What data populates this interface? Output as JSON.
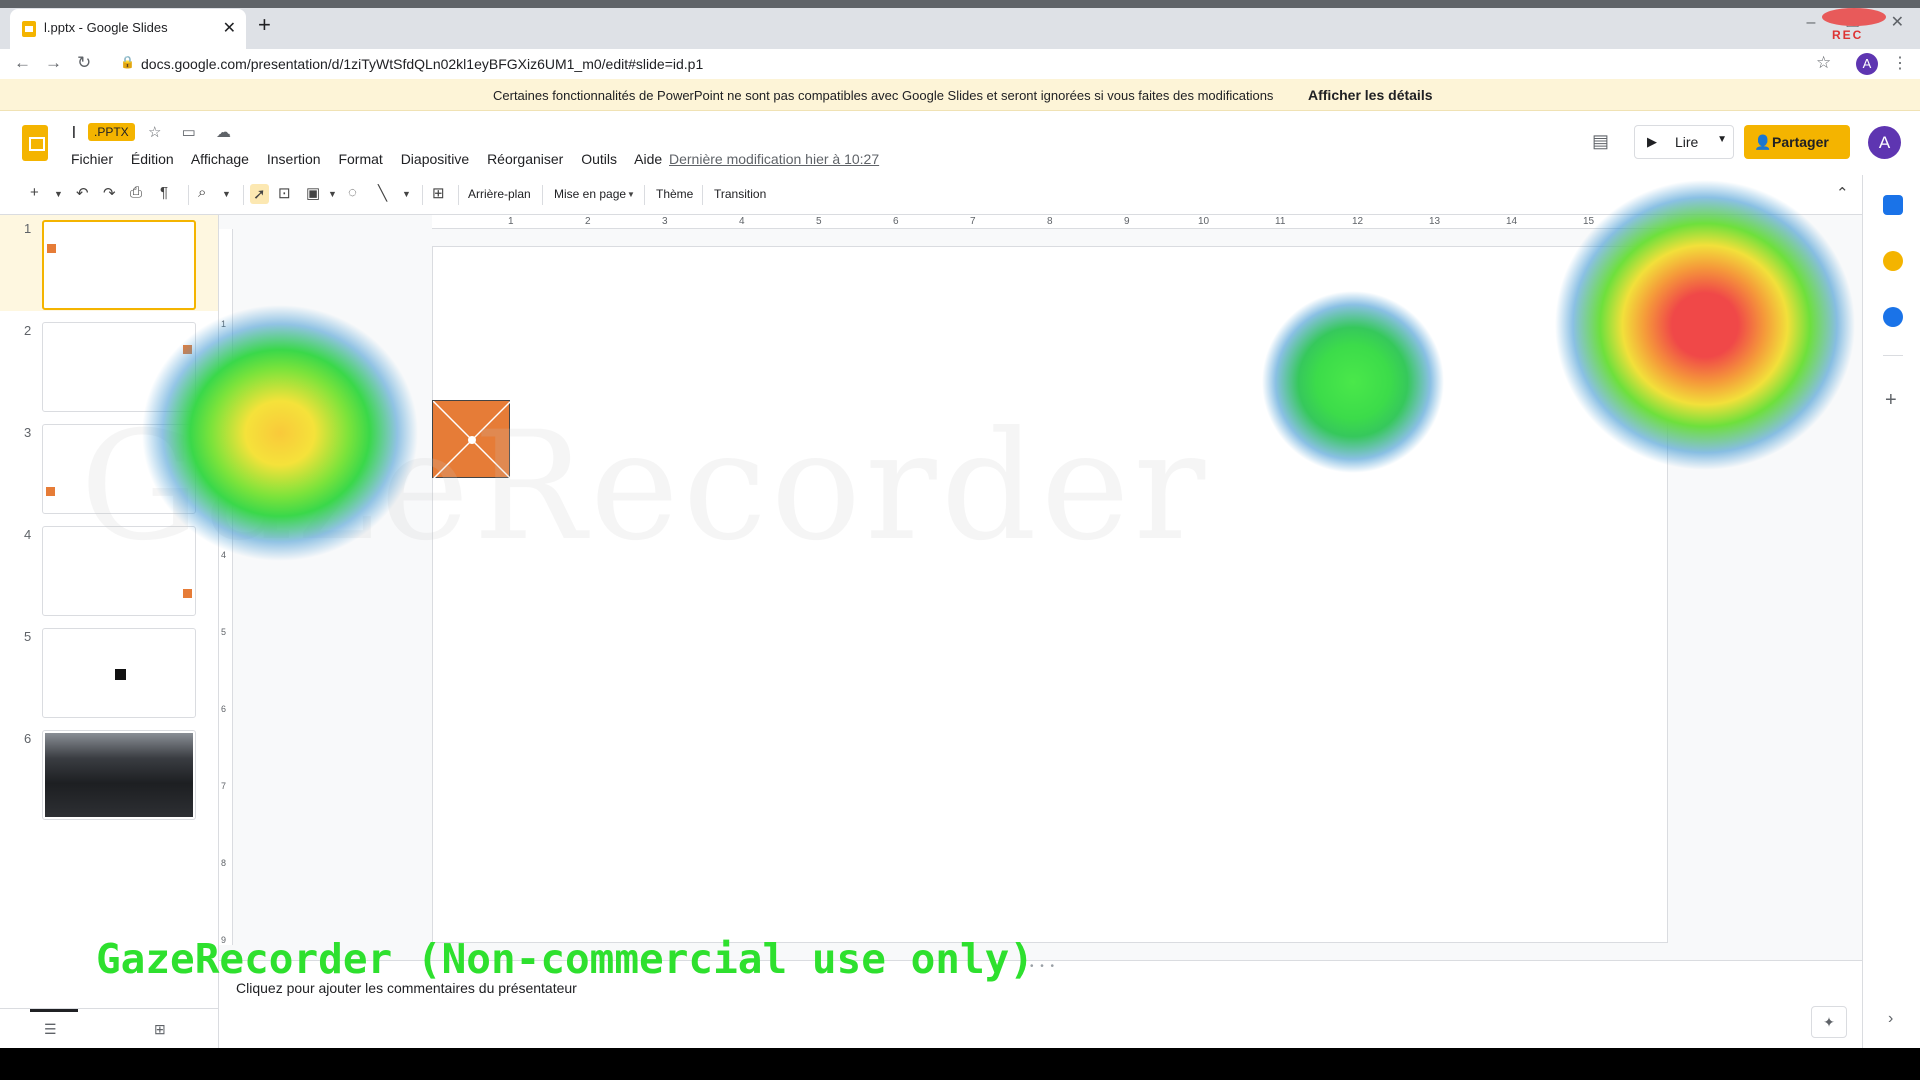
{
  "browser": {
    "tab_title": "l.pptx - Google Slides",
    "tab_close": "✕",
    "new_tab": "+",
    "url": "docs.google.com/presentation/d/1ziTyWtSfdQLn02kl1eyBFGXiz6UM1_m0/edit#slide=id.p1",
    "profile_initial": "A",
    "rec_label": "REC"
  },
  "banner": {
    "message": "Certaines fonctionnalités de PowerPoint ne sont pas compatibles avec Google Slides et seront ignorées si vous faites des modifications",
    "details_link": "Afficher les détails"
  },
  "header": {
    "doc_name": "l",
    "file_badge": ".PPTX",
    "menu": [
      "Fichier",
      "Édition",
      "Affichage",
      "Insertion",
      "Format",
      "Diapositive",
      "Réorganiser",
      "Outils",
      "Aide"
    ],
    "last_modified": "Dernière modification hier à 10:27",
    "present_label": "Lire",
    "share_label": "Partager",
    "avatar_initial": "A"
  },
  "toolbar": {
    "background": "Arrière-plan",
    "layout": "Mise en page",
    "theme": "Thème",
    "transition": "Transition"
  },
  "filmstrip": {
    "slides": [
      {
        "num": "1",
        "active": true
      },
      {
        "num": "2",
        "active": false
      },
      {
        "num": "3",
        "active": false
      },
      {
        "num": "4",
        "active": false
      },
      {
        "num": "5",
        "active": false
      },
      {
        "num": "6",
        "active": false
      }
    ]
  },
  "ruler": {
    "h_ticks": [
      "1",
      "2",
      "3",
      "4",
      "5",
      "6",
      "7",
      "8",
      "9",
      "10",
      "11",
      "12",
      "13",
      "14",
      "15"
    ],
    "v_ticks": [
      "1",
      "2",
      "3",
      "4",
      "5",
      "6",
      "7",
      "8",
      "9"
    ]
  },
  "notes": {
    "placeholder": "Cliquez pour ajouter les commentaires du présentateur"
  },
  "overlay": {
    "watermark": "GazeRecorder",
    "banner": "GazeRecorder (Non-commercial use only)"
  },
  "colors": {
    "accent": "#f4b400",
    "shape_fill": "#e67c37",
    "overlay_green": "#2ee02e"
  }
}
